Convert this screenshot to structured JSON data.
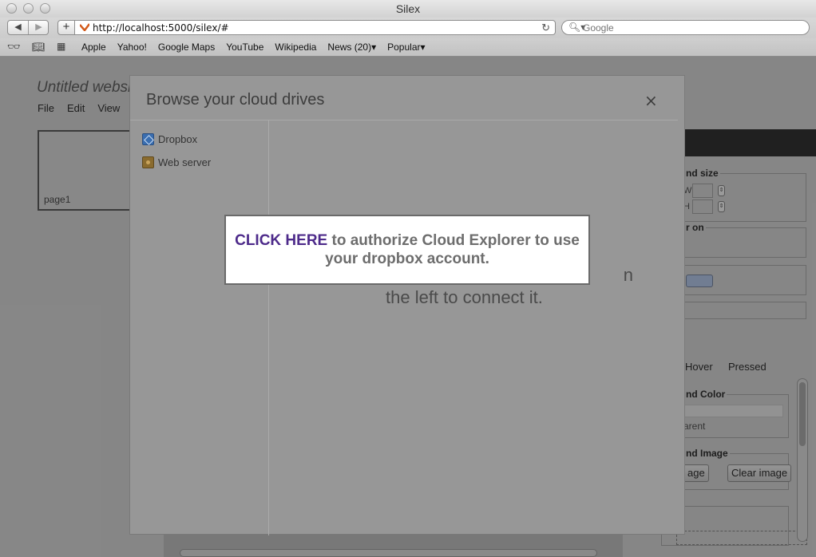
{
  "window": {
    "title": "Silex"
  },
  "toolbar": {
    "url": "http://localhost:5000/silex/#",
    "search_placeholder": "Google"
  },
  "bookmarks": [
    {
      "label": "Apple"
    },
    {
      "label": "Yahoo!"
    },
    {
      "label": "Google Maps"
    },
    {
      "label": "YouTube"
    },
    {
      "label": "Wikipedia"
    },
    {
      "label": "News (20)▾"
    },
    {
      "label": "Popular▾"
    }
  ],
  "app": {
    "site_title": "Untitled website",
    "menu": [
      "File",
      "Edit",
      "View"
    ],
    "page_thumb_label": "page1",
    "props": {
      "bg_size_legend": "nd size",
      "w_label": "W",
      "h_label": "H",
      "fs2_legend": "r on",
      "states": [
        "Hover",
        "Pressed"
      ],
      "bg_color_legend": "nd Color",
      "transparent_label": "arent",
      "bg_image_legend": "nd Image",
      "image_btn": "age",
      "clear_image_btn": "Clear image"
    }
  },
  "dialog": {
    "title": "Browse your cloud drives",
    "close_label": "×",
    "drives": [
      {
        "name": "Dropbox",
        "icon": "dropbox-icon"
      },
      {
        "name": "Web server",
        "icon": "folder-icon"
      }
    ],
    "hint_line1": "n",
    "hint_line2": "the left to connect it."
  },
  "auth_popup": {
    "link_text": "CLICK HERE",
    "rest_text": " to authorize Cloud Explorer to use your dropbox account."
  }
}
